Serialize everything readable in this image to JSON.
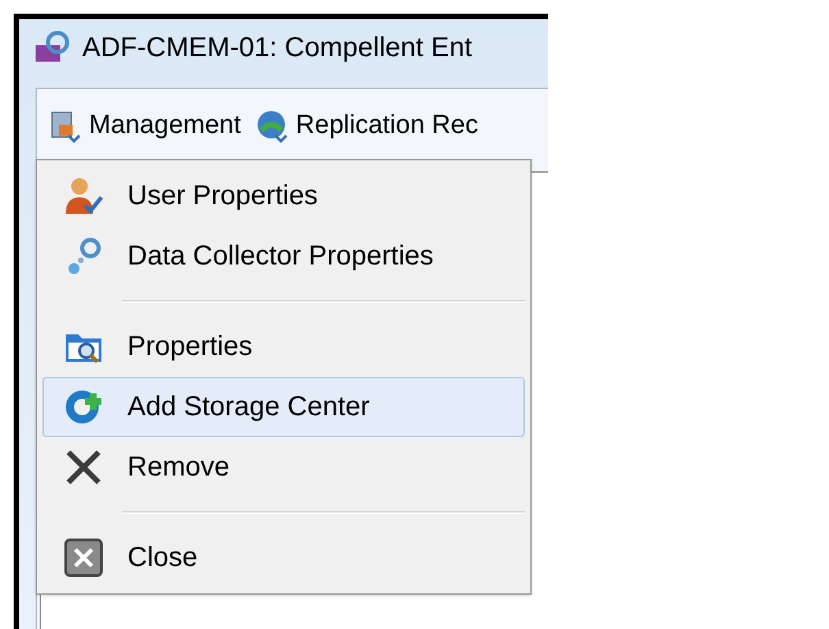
{
  "window": {
    "title": "ADF-CMEM-01: Compellent Ent"
  },
  "toolbar": [
    {
      "label": "Management"
    },
    {
      "label": "Replication Rec"
    }
  ],
  "menu": [
    {
      "kind": "item",
      "label": "User Properties",
      "selected": false
    },
    {
      "kind": "item",
      "label": "Data Collector Properties",
      "selected": false
    },
    {
      "kind": "separator"
    },
    {
      "kind": "item",
      "label": "Properties",
      "selected": false
    },
    {
      "kind": "item",
      "label": "Add Storage Center",
      "selected": true
    },
    {
      "kind": "item",
      "label": "Remove",
      "selected": false
    },
    {
      "kind": "separator"
    },
    {
      "kind": "item",
      "label": "Close",
      "selected": false
    }
  ]
}
